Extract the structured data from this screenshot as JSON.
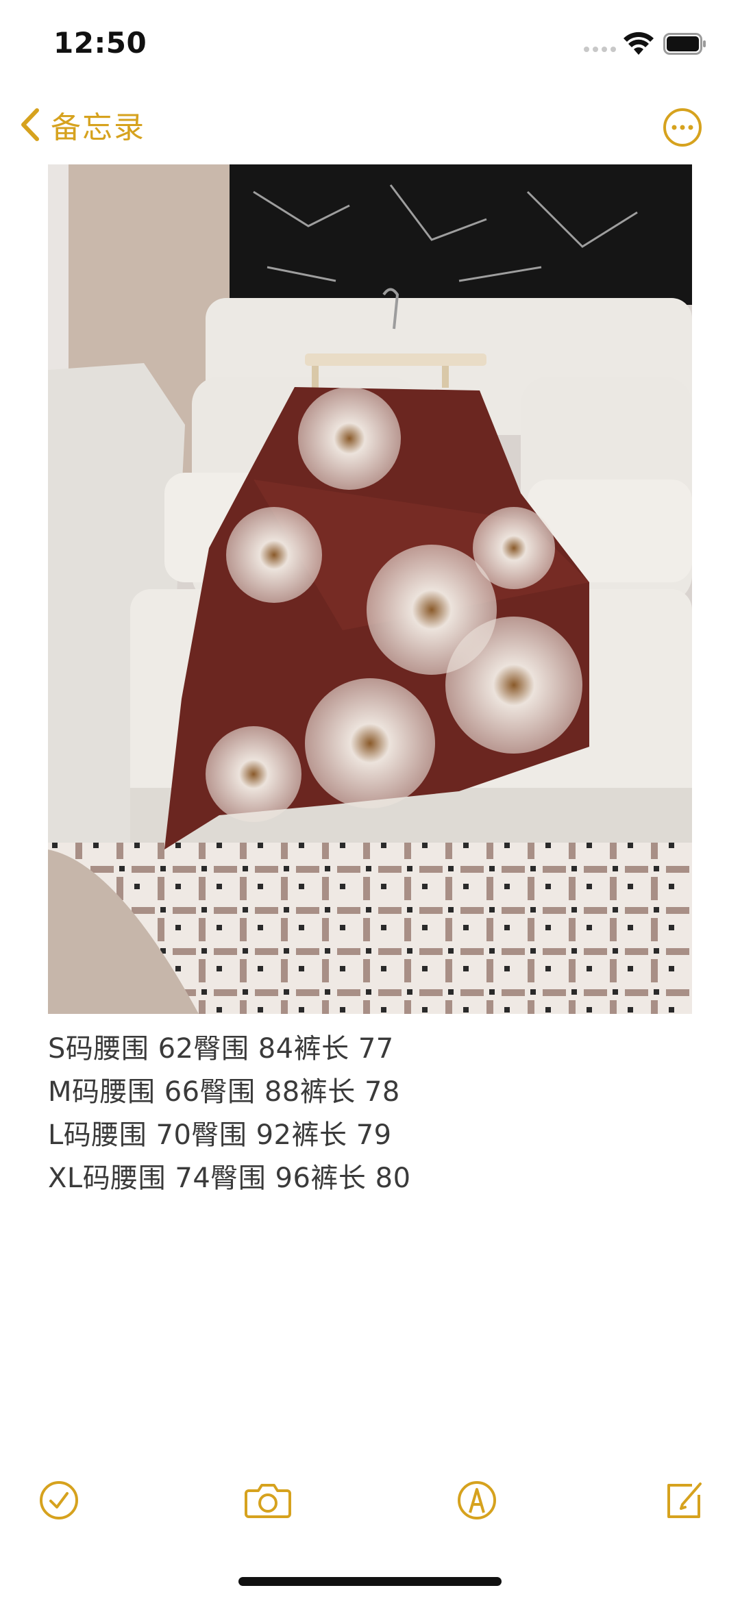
{
  "status_bar": {
    "time": "12:50",
    "icons": [
      "cellular-signal-icon",
      "wifi-icon",
      "battery-icon"
    ]
  },
  "nav": {
    "back_label": "备忘录",
    "back_icon": "chevron-left-icon",
    "more_icon": "ellipsis-circle-icon"
  },
  "note": {
    "image_alt": "photo of a burgundy floral print skirt on a hanger lying on a white sofa",
    "lines": [
      "S码腰围 62臀围 84裤长 77",
      "M码腰围 66臀围 88裤长 78",
      "L码腰围 70臀围 92裤长 79",
      "XL码腰围 74臀围 96裤长 80"
    ]
  },
  "toolbar": {
    "items": [
      "checklist-icon",
      "camera-icon",
      "markup-icon",
      "compose-icon"
    ]
  },
  "colors": {
    "accent": "#d6a21e",
    "text": "#3a3a3a",
    "background": "#ffffff"
  }
}
